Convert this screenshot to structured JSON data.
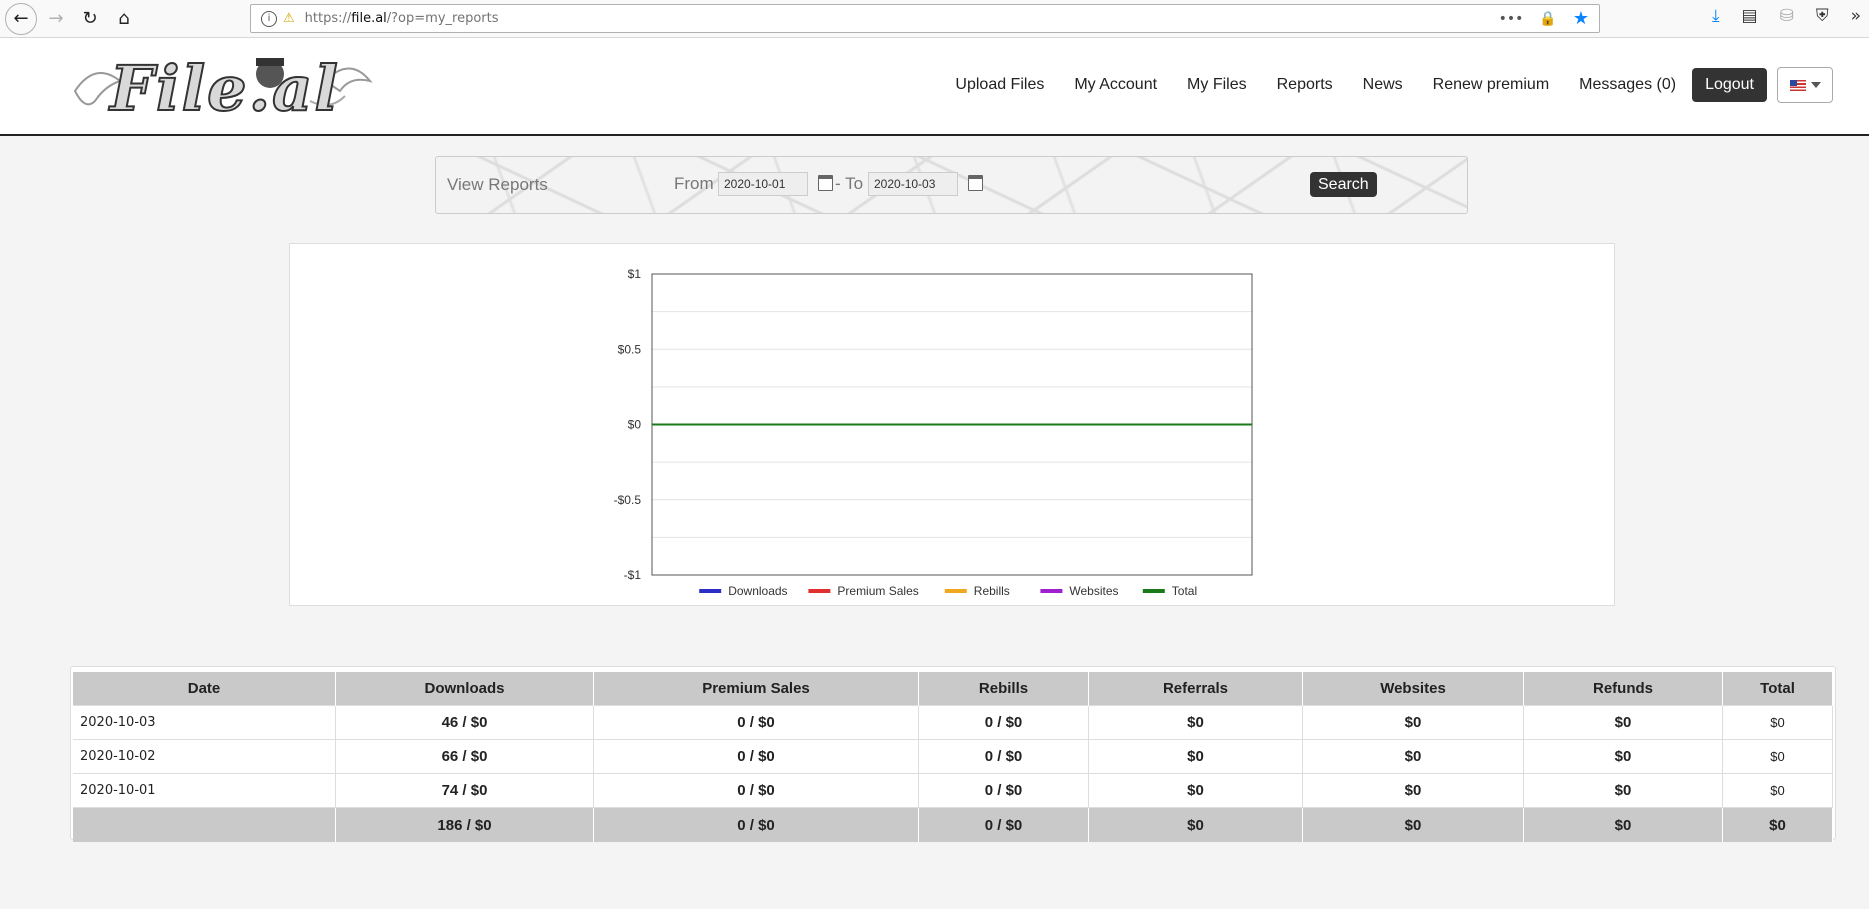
{
  "browser": {
    "url_prefix": "https://",
    "url_host": "file.al",
    "url_path": "/?op=my_reports",
    "more_label": "•••"
  },
  "header": {
    "logo_text": "File.al",
    "nav": [
      "Upload Files",
      "My Account",
      "My Files",
      "Reports",
      "News",
      "Renew premium",
      "Messages (0)"
    ],
    "logout_label": "Logout"
  },
  "filter": {
    "title": "View Reports",
    "from_label": "From",
    "from_value": "2020-10-01",
    "to_label": "- To",
    "to_value": "2020-10-03",
    "search_label": "Search"
  },
  "chart_data": {
    "type": "line",
    "ylim": [
      -1,
      1
    ],
    "yticks": [
      "$1",
      "$0.5",
      "$0",
      "-$0.5",
      "-$1"
    ],
    "ytick_values": [
      1,
      0.5,
      0,
      -0.5,
      -1
    ],
    "series": [
      {
        "name": "Downloads",
        "color": "#2d2dc8",
        "values": [
          0,
          0,
          0
        ]
      },
      {
        "name": "Premium Sales",
        "color": "#e03030",
        "values": [
          0,
          0,
          0
        ]
      },
      {
        "name": "Rebills",
        "color": "#f0a820",
        "values": [
          0,
          0,
          0
        ]
      },
      {
        "name": "Websites",
        "color": "#a020d0",
        "values": [
          0,
          0,
          0
        ]
      },
      {
        "name": "Total",
        "color": "#1a7a1a",
        "values": [
          0,
          0,
          0
        ]
      }
    ],
    "legend_position": "bottom",
    "grid": true
  },
  "table": {
    "headers": [
      "Date",
      "Downloads",
      "Premium Sales",
      "Rebills",
      "Referrals",
      "Websites",
      "Refunds",
      "Total"
    ],
    "rows": [
      [
        "2020-10-03",
        "46 / $0",
        "0 / $0",
        "0 / $0",
        "$0",
        "$0",
        "$0",
        "$0"
      ],
      [
        "2020-10-02",
        "66 / $0",
        "0 / $0",
        "0 / $0",
        "$0",
        "$0",
        "$0",
        "$0"
      ],
      [
        "2020-10-01",
        "74 / $0",
        "0 / $0",
        "0 / $0",
        "$0",
        "$0",
        "$0",
        "$0"
      ]
    ],
    "summary": [
      "",
      "186 / $0",
      "0 / $0",
      "0 / $0",
      "$0",
      "$0",
      "$0",
      "$0"
    ]
  }
}
